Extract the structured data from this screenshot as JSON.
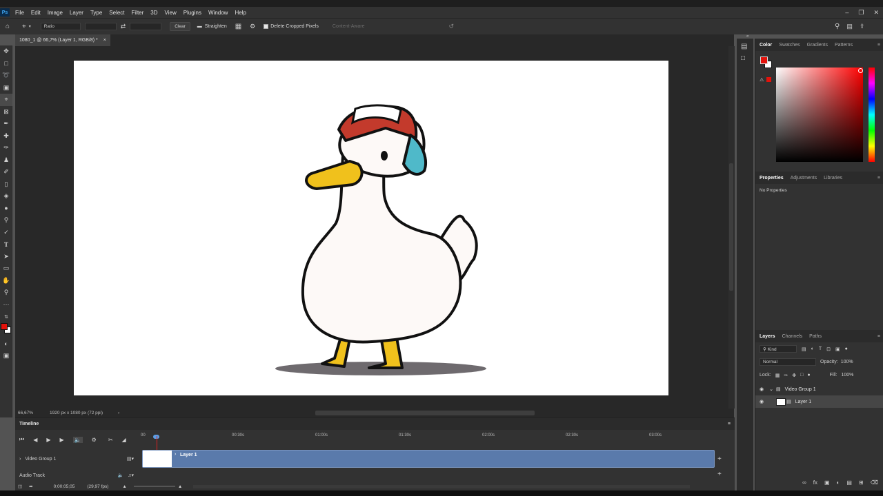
{
  "app": {
    "logo": "Ps"
  },
  "menu": [
    "File",
    "Edit",
    "Image",
    "Layer",
    "Type",
    "Select",
    "Filter",
    "3D",
    "View",
    "Plugins",
    "Window",
    "Help"
  ],
  "options": {
    "ratio_label": "Ratio",
    "clear_label": "Clear",
    "straighten_label": "Straighten",
    "delete_cropped_label": "Delete Cropped Pixels",
    "content_aware_label": "Content-Aware"
  },
  "document": {
    "tab_title": "1080_1 @ 66,7% (Layer 1, RGB/8) *",
    "tab_close": "×"
  },
  "status": {
    "zoom": "66,67%",
    "info": "1920 px x 1080 px (72 ppi)"
  },
  "timeline": {
    "title": "Timeline",
    "ruler_start": "00",
    "ticks": [
      "00:30s",
      "01:00s",
      "01:30s",
      "02:00s",
      "02:30s",
      "03:00s"
    ],
    "video_group_label": "Video Group 1",
    "clip_label": "Layer 1",
    "audio_track_label": "Audio Track",
    "timecode": "0;00;05;05",
    "fps": "(29,97 fps)"
  },
  "color_panel": {
    "tabs": [
      "Color",
      "Swatches",
      "Gradients",
      "Patterns"
    ],
    "fg_color": "#e3120b",
    "bg_color": "#ffffff",
    "warning_swatch": "#e3120b"
  },
  "properties_panel": {
    "tabs": [
      "Properties",
      "Adjustments",
      "Libraries"
    ],
    "body": "No Properties"
  },
  "layers_panel": {
    "tabs": [
      "Layers",
      "Channels",
      "Paths"
    ],
    "filter_label": "Kind",
    "blend_mode": "Normal",
    "opacity_label": "Opacity:",
    "opacity_value": "100%",
    "lock_label": "Lock:",
    "fill_label": "Fill:",
    "fill_value": "100%",
    "layers": [
      {
        "name": "Video Group 1",
        "type": "group"
      },
      {
        "name": "Layer 1",
        "type": "video-layer"
      }
    ]
  },
  "colors": {
    "accent": "#3fa9f5",
    "clip": "#5a7aab",
    "playhead": "#dd2222",
    "canvas": "#ffffff"
  }
}
